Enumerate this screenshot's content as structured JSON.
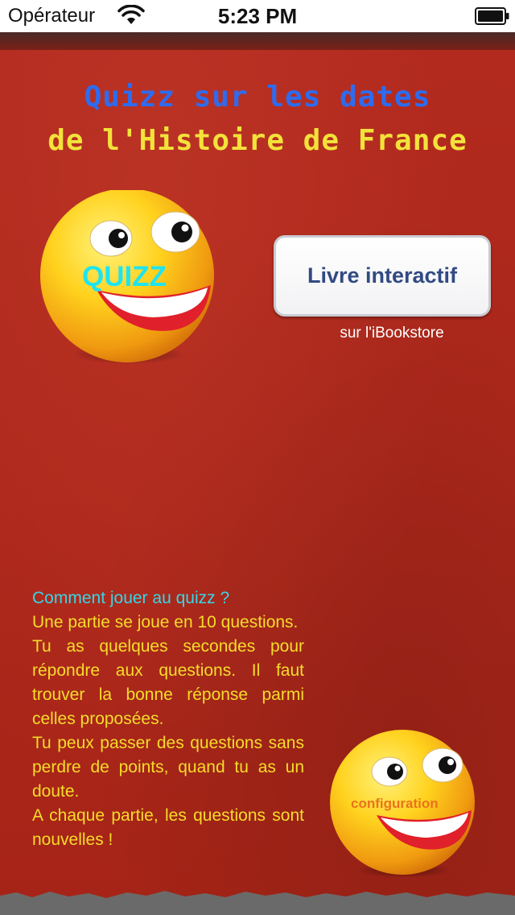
{
  "status_bar": {
    "carrier": "Opérateur",
    "time": "5:23 PM",
    "wifi_icon": "wifi-icon",
    "battery_icon": "battery-icon"
  },
  "title": {
    "line1": "Quizz sur les dates",
    "line2": "de l'Histoire de France"
  },
  "quiz_button": {
    "label": "QUIZZ",
    "icon": "smiley-icon"
  },
  "book": {
    "button_label": "Livre interactif",
    "subtitle": "sur l'iBookstore"
  },
  "howto": {
    "question": "Comment jouer au quizz ?",
    "paragraphs": [
      "Une partie se joue en 10 questions.",
      "Tu as quelques secondes pour répondre aux questions. Il faut trouver la bonne réponse parmi celles proposées.",
      "Tu peux passer des questions sans perdre de points, quand tu as un doute.",
      "A chaque partie, les questions sont nouvelles !"
    ]
  },
  "config_button": {
    "label": "configuration",
    "icon": "smiley-icon"
  },
  "colors": {
    "background": "#ad271b",
    "title_blue": "#2d6cf0",
    "title_yellow": "#f3e23a",
    "howto_cyan": "#36d6e6",
    "howto_yellow": "#f5dc2a",
    "quiz_label": "#1fe4f0",
    "config_label": "#e8731c",
    "book_button_text": "#324a82"
  }
}
